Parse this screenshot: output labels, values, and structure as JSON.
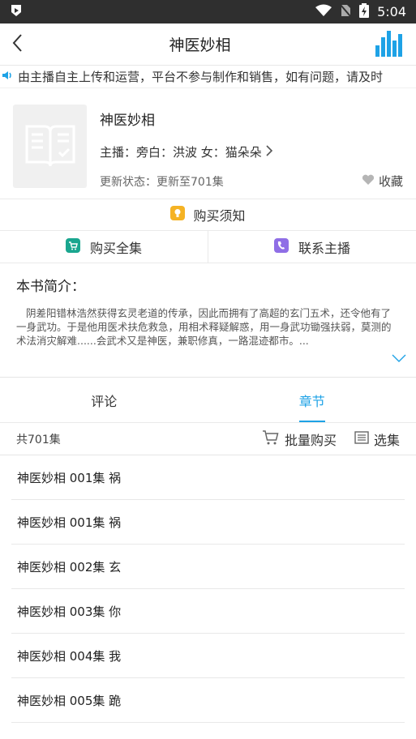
{
  "status_bar": {
    "time": "5:04"
  },
  "header": {
    "title": "神医妙相"
  },
  "marquee": {
    "text": "由主播自主上传和运营，平台不参与制作和销售，如有问题，请及时"
  },
  "book": {
    "title": "神医妙相",
    "host": "主播：旁白：洪波  女：猫朵朵",
    "update": "更新状态：更新至701集",
    "favorite_label": "收藏"
  },
  "notice": {
    "label": "购买须知"
  },
  "actions": {
    "buy_all": "购买全集",
    "contact": "联系主播"
  },
  "intro": {
    "title": "本书简介：",
    "text": "阴差阳错林浩然获得玄灵老道的传承，因此而拥有了高超的玄门五术，还令他有了一身武功。于是他用医术扶危救急，用相术释疑解惑，用一身武功锄强扶弱，莫测的术法消灾解难......会武术又是神医，兼职修真，一路混迹都市。..."
  },
  "tabs": [
    {
      "label": "评论"
    },
    {
      "label": "章节"
    }
  ],
  "episodes": {
    "count_label": "共701集",
    "batch_buy": "批量购买",
    "select": "选集",
    "items": [
      "神医妙相 001集 祸",
      "神医妙相 001集 祸",
      "神医妙相 002集 玄",
      "神医妙相 003集 你",
      "神医妙相 004集 我",
      "神医妙相 005集 跪"
    ]
  },
  "colors": {
    "accent": "#1ea2e6",
    "notice_icon": "#f5b324",
    "cart_icon": "#1aa68f",
    "phone_icon": "#8f6ee6"
  }
}
